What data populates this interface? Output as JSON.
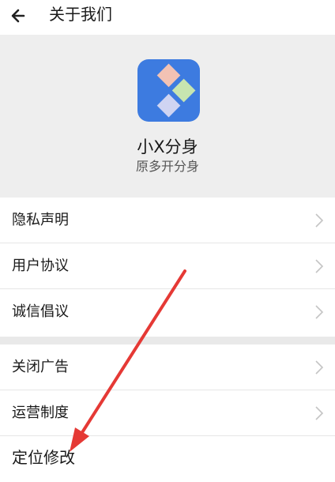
{
  "header": {
    "title": "关于我们",
    "back_icon": "arrow-left-icon"
  },
  "app": {
    "name": "小X分身",
    "subtitle": "原多开分身",
    "icon_name": "app-logo-icon",
    "icon_bg": "#3d7be0"
  },
  "menu_group_1": [
    {
      "label": "隐私声明"
    },
    {
      "label": "用户协议"
    },
    {
      "label": "诚信倡议"
    }
  ],
  "menu_group_2": [
    {
      "label": "关闭广告"
    },
    {
      "label": "运营制度"
    },
    {
      "label": "定位修改"
    }
  ],
  "annotation_color": "#e53935"
}
